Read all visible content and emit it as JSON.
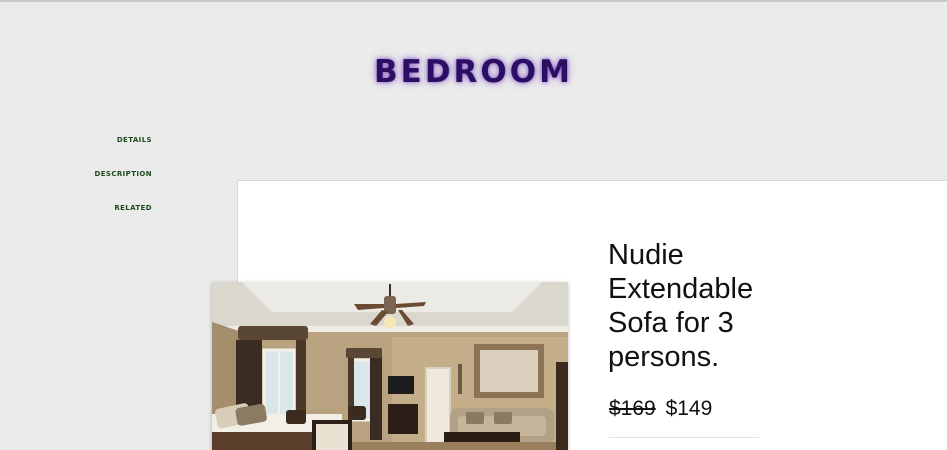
{
  "header": {
    "title": "BEDROOM"
  },
  "side_nav": {
    "items": [
      {
        "label": "DETAILS"
      },
      {
        "label": "DESCRIPTION"
      },
      {
        "label": "RELATED"
      }
    ]
  },
  "product": {
    "name": "Nudie Extendable Sofa for 3 persons.",
    "image_description": "bedroom-photo",
    "price_old": "$169",
    "price_new": "$149"
  },
  "colors": {
    "title": "#2c0f63",
    "nav_text": "#1c4a1c",
    "card_bg": "#ffffff",
    "page_bg": "#ebebeb"
  }
}
